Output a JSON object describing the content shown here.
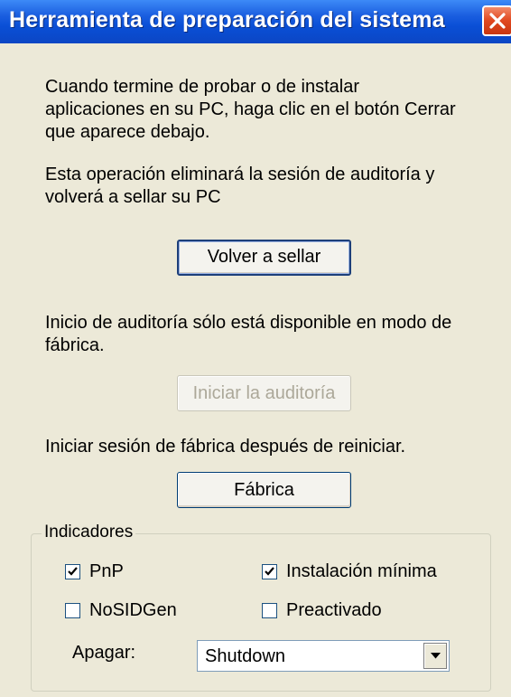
{
  "window": {
    "title": "Herramienta de preparación del sistema"
  },
  "intro": {
    "line1": "Cuando termine de probar o de instalar",
    "line2": "aplicaciones en su PC, haga clic en el botón Cerrar",
    "line3": "que aparece debajo."
  },
  "reseal": {
    "line1": "Esta operación eliminará la sesión de auditoría y",
    "line2": "volverá a sellar su PC",
    "button_label": "Volver a sellar"
  },
  "audit": {
    "line1": "Inicio de auditoría sólo está disponible en modo de",
    "line2": "fábrica.",
    "button_label": "Iniciar la auditoría"
  },
  "factory": {
    "text": "Iniciar sesión de fábrica después de reiniciar.",
    "button_label": "Fábrica"
  },
  "flags": {
    "group_label": "Indicadores",
    "pnp": {
      "label": "PnP",
      "checked": true
    },
    "minimal_install": {
      "label": "Instalación mínima",
      "checked": true
    },
    "nosidgen": {
      "label": "NoSIDGen",
      "checked": false
    },
    "preactivated": {
      "label": "Preactivado",
      "checked": false
    },
    "shutdown_label": "Apagar:",
    "shutdown_value": "Shutdown"
  }
}
